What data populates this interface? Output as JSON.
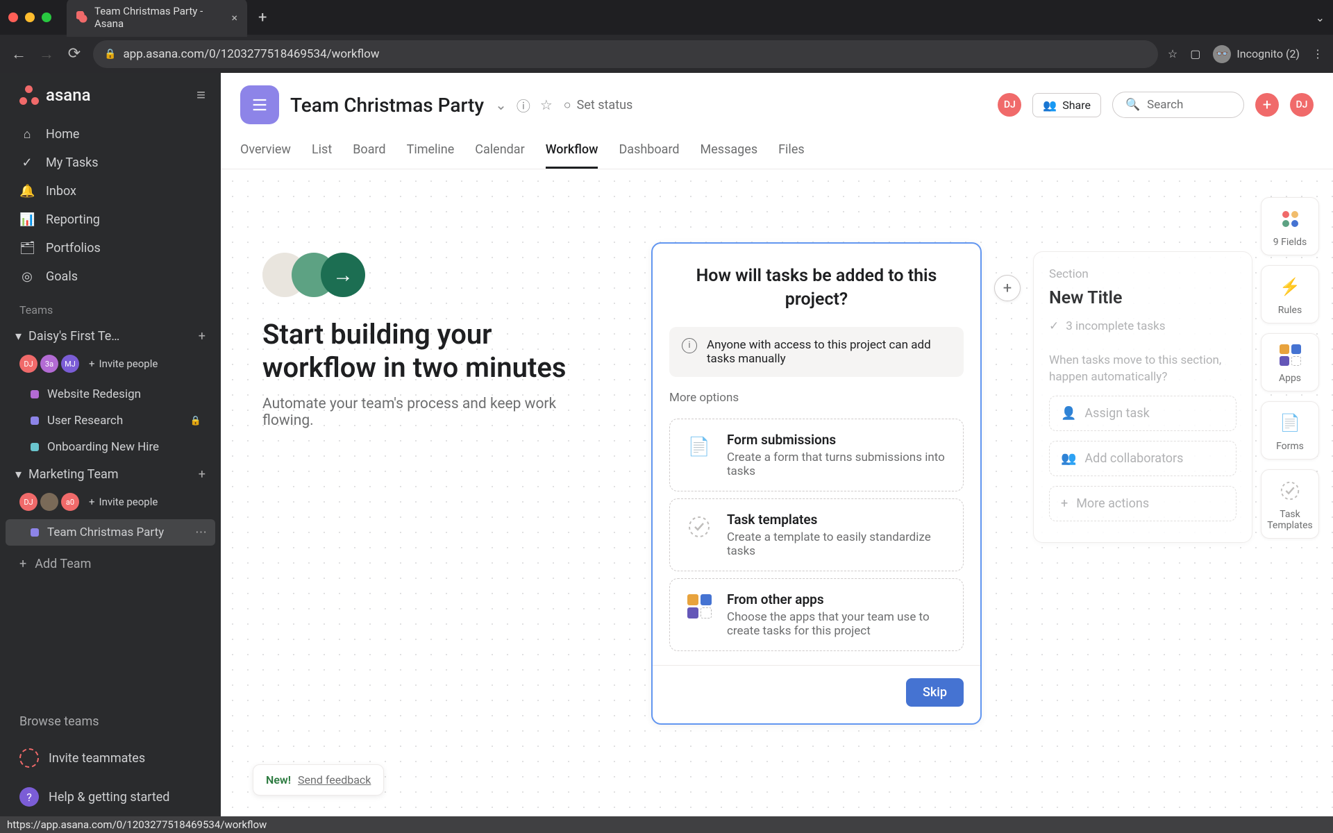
{
  "browser": {
    "tab_title": "Team Christmas Party - Asana",
    "url": "app.asana.com/0/1203277518469534/workflow",
    "incognito_label": "Incognito (2)",
    "status_url": "https://app.asana.com/0/1203277518469534/workflow"
  },
  "sidebar": {
    "logo": "asana",
    "nav": [
      {
        "icon": "home",
        "label": "Home"
      },
      {
        "icon": "check",
        "label": "My Tasks"
      },
      {
        "icon": "bell",
        "label": "Inbox"
      },
      {
        "icon": "chart",
        "label": "Reporting"
      },
      {
        "icon": "briefcase",
        "label": "Portfolios"
      },
      {
        "icon": "target",
        "label": "Goals"
      }
    ],
    "teams_header": "Teams",
    "teams": [
      {
        "name": "Daisy's First Te…",
        "members": [
          {
            "initials": "DJ",
            "color": "#f06a6a"
          },
          {
            "initials": "3a",
            "color": "#b36bd4"
          },
          {
            "initials": "MJ",
            "color": "#7b5dd6"
          }
        ],
        "invite": "Invite people",
        "projects": [
          {
            "name": "Website Redesign",
            "color": "#b36bd4",
            "locked": false
          },
          {
            "name": "User Research",
            "color": "#8d84e8",
            "locked": true
          },
          {
            "name": "Onboarding New Hire",
            "color": "#6ac5ce",
            "locked": false
          }
        ]
      },
      {
        "name": "Marketing Team",
        "members": [
          {
            "initials": "DJ",
            "color": "#f06a6a"
          },
          {
            "initials": "",
            "color": "#7a6a58"
          },
          {
            "initials": "a0",
            "color": "#f06a6a"
          }
        ],
        "invite": "Invite people",
        "projects": [
          {
            "name": "Team Christmas Party",
            "color": "#8d84e8",
            "active": true
          }
        ]
      }
    ],
    "add_team": "Add Team",
    "browse_teams": "Browse teams",
    "invite_teammates": "Invite teammates",
    "help": "Help & getting started"
  },
  "header": {
    "project_title": "Team Christmas Party",
    "set_status": "Set status",
    "share": "Share",
    "search_placeholder": "Search",
    "user_initials": "DJ",
    "avatar_initials": "DJ",
    "tabs": [
      "Overview",
      "List",
      "Board",
      "Timeline",
      "Calendar",
      "Workflow",
      "Dashboard",
      "Messages",
      "Files"
    ],
    "active_tab": "Workflow"
  },
  "canvas": {
    "intro_heading": "Start building your workflow in two minutes",
    "intro_sub": "Automate your team's process and keep work flowing.",
    "card": {
      "title": "How will tasks be added to this project?",
      "info": "Anyone with access to this project can add tasks manually",
      "more_options": "More options",
      "options": [
        {
          "title": "Form submissions",
          "desc": "Create a form that turns submissions into tasks",
          "icon": "form"
        },
        {
          "title": "Task templates",
          "desc": "Create a template to easily standardize tasks",
          "icon": "check-dashed"
        },
        {
          "title": "From other apps",
          "desc": "Choose the apps that your team use to create tasks for this project",
          "icon": "apps"
        }
      ],
      "skip": "Skip"
    },
    "secondary": {
      "label": "Section",
      "title": "New Title",
      "incomplete": "3 incomplete tasks",
      "prompt": "When tasks move to this section, happen automatically?",
      "opts": [
        "Assign task",
        "Add collaborators",
        "More actions"
      ]
    },
    "toolbox": [
      {
        "label": "9 Fields",
        "icon": "fields"
      },
      {
        "label": "Rules",
        "icon": "bolt"
      },
      {
        "label": "Apps",
        "icon": "apps"
      },
      {
        "label": "Forms",
        "icon": "forms"
      },
      {
        "label": "Task Templates",
        "icon": "template"
      }
    ],
    "feedback": {
      "new": "New!",
      "link": "Send feedback"
    }
  }
}
